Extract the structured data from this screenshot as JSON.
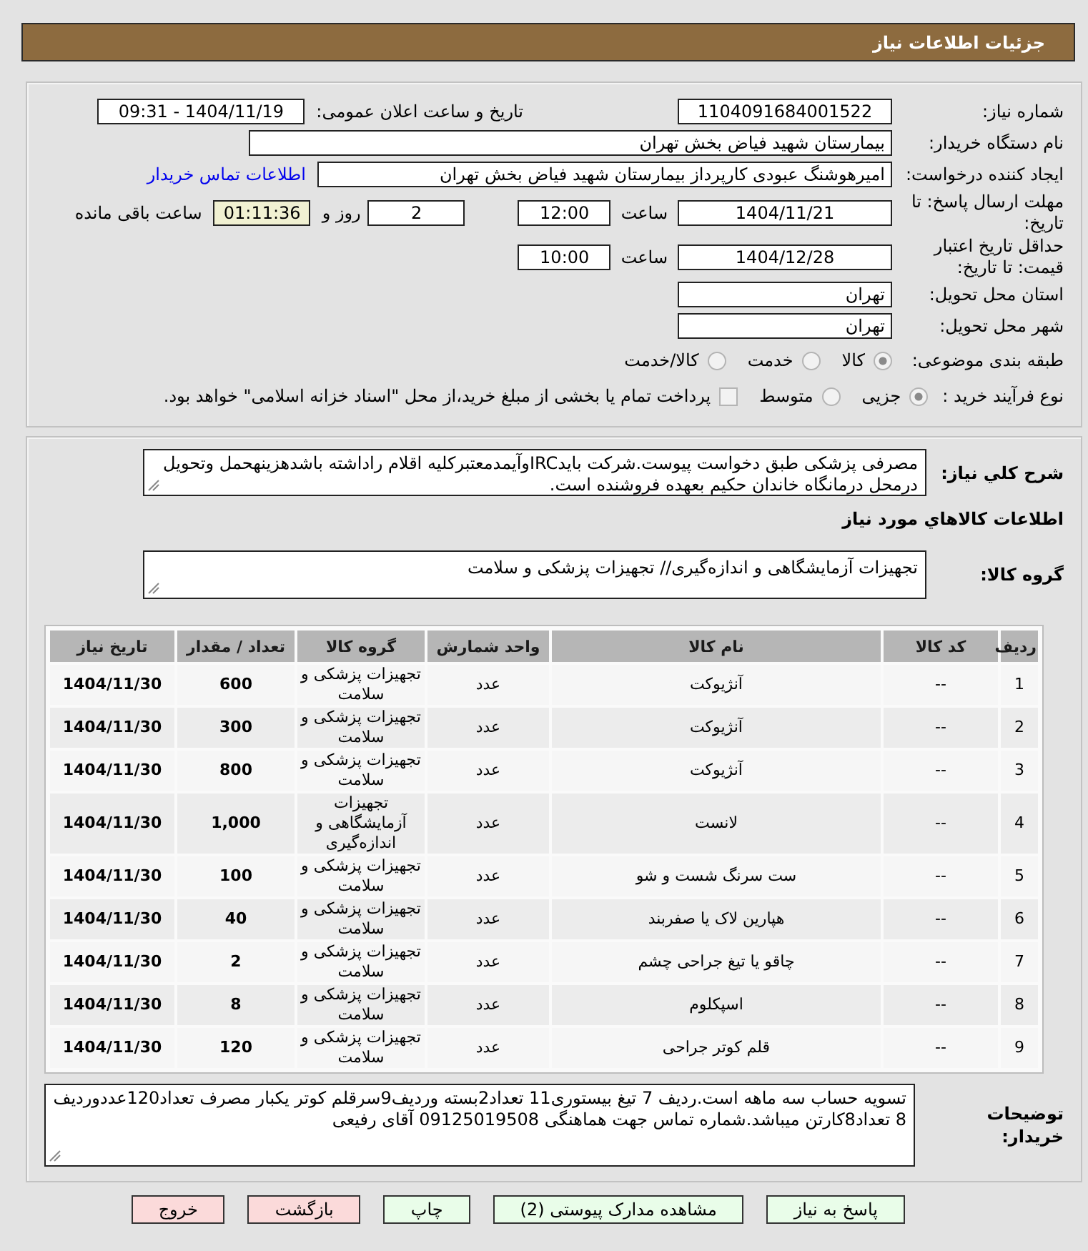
{
  "header": {
    "title": "جزئیات اطلاعات نیاز"
  },
  "need": {
    "number_label": "شماره نیاز:",
    "number": "1104091684001522",
    "announce_label": "تاریخ و ساعت اعلان عمومی:",
    "announce": "1404/11/19 - 09:31"
  },
  "buyer": {
    "label": "نام دستگاه خریدار:",
    "value": "بیمارستان شهید فیاض بخش تهران"
  },
  "requester": {
    "label": "ایجاد کننده درخواست:",
    "value": "امیرهوشنگ عبودی کارپرداز بیمارستان شهید فیاض بخش تهران",
    "contact_link": "اطلاعات تماس خریدار"
  },
  "deadline": {
    "label": "مهلت ارسال پاسخ: تا تاریخ:",
    "date": "1404/11/21",
    "time_label": "ساعت",
    "time": "12:00",
    "days": "2",
    "days_label": "روز و",
    "remaining": "01:11:36",
    "remaining_label": "ساعت باقی مانده"
  },
  "validity": {
    "label": "حداقل تاریخ اعتبار قیمت: تا تاریخ:",
    "date": "1404/12/28",
    "time_label": "ساعت",
    "time": "10:00"
  },
  "province": {
    "label": "استان محل تحویل:",
    "value": "تهران"
  },
  "city": {
    "label": "شهر محل تحویل:",
    "value": "تهران"
  },
  "category": {
    "label": "طبقه بندی موضوعی:",
    "options": [
      {
        "label": "کالا",
        "selected": true
      },
      {
        "label": "خدمت",
        "selected": false
      },
      {
        "label": "کالا/خدمت",
        "selected": false
      }
    ]
  },
  "purchase_type": {
    "label": "نوع فرآیند خرید :",
    "options": [
      {
        "label": "جزیی",
        "selected": true
      },
      {
        "label": "متوسط",
        "selected": false
      }
    ],
    "treasury": {
      "label": "پرداخت تمام یا بخشی از مبلغ خرید،از محل \"اسناد خزانه اسلامی\" خواهد بود.",
      "checked": false
    }
  },
  "description": {
    "label": "شرح كلي نياز:",
    "value": "مصرفی پزشکی طبق دخواست پیوست.شرکت بایدIRCوآیمدمعتبرکلیه اقلام راداشته باشدهزینهحمل وتحویل درمحل درمانگاه خاندان حکیم بعهده فروشنده است."
  },
  "goods": {
    "title": "اطلاعات كالاهاي مورد نياز",
    "group_label": "گروه کالا:",
    "group": "تجهیزات آزمایشگاهی و اندازه‌گیری// تجهیزات پزشکی و سلامت"
  },
  "table": {
    "columns": [
      "ردیف",
      "کد کالا",
      "نام کالا",
      "واحد شمارش",
      "گروه کالا",
      "تعداد / مقدار",
      "تاریخ نیاز"
    ],
    "rows": [
      [
        "1",
        "--",
        "آنژیوکت",
        "عدد",
        "تجهیزات پزشکی و سلامت",
        "600",
        "1404/11/30"
      ],
      [
        "2",
        "--",
        "آنژیوکت",
        "عدد",
        "تجهیزات پزشکی و سلامت",
        "300",
        "1404/11/30"
      ],
      [
        "3",
        "--",
        "آنژیوکت",
        "عدد",
        "تجهیزات پزشکی و سلامت",
        "800",
        "1404/11/30"
      ],
      [
        "4",
        "--",
        "لانست",
        "عدد",
        "تجهیزات آزمایشگاهی و اندازه‌گیری",
        "1,000",
        "1404/11/30"
      ],
      [
        "5",
        "--",
        "ست سرنگ شست و شو",
        "عدد",
        "تجهیزات پزشکی و سلامت",
        "100",
        "1404/11/30"
      ],
      [
        "6",
        "--",
        "هپارین لاک یا صفربند",
        "عدد",
        "تجهیزات پزشکی و سلامت",
        "40",
        "1404/11/30"
      ],
      [
        "7",
        "--",
        "چاقو یا تیغ جراحی چشم",
        "عدد",
        "تجهیزات پزشکی و سلامت",
        "2",
        "1404/11/30"
      ],
      [
        "8",
        "--",
        "اسپکلوم",
        "عدد",
        "تجهیزات پزشکی و سلامت",
        "8",
        "1404/11/30"
      ],
      [
        "9",
        "--",
        "قلم کوتر جراحی",
        "عدد",
        "تجهیزات پزشکی و سلامت",
        "120",
        "1404/11/30"
      ]
    ]
  },
  "notes": {
    "label": "توضیحات خریدار:",
    "value": "تسویه حساب سه ماهه است.ردیف 7 تیغ بیستوری11 تعداد2بسته وردیف9سرقلم کوتر یکبار مصرف تعداد120عددوردیف 8 تعداد8کارتن میباشد.شماره تماس جهت هماهنگی 09125019508 آقای رفیعی"
  },
  "buttons": [
    {
      "label": "پاسخ به نیاز",
      "kind": "action"
    },
    {
      "label": "مشاهده مدارک پیوستی (2)",
      "kind": "action"
    },
    {
      "label": "چاپ",
      "kind": "action"
    },
    {
      "label": "بازگشت",
      "kind": "exit"
    },
    {
      "label": "خروج",
      "kind": "exit"
    }
  ]
}
